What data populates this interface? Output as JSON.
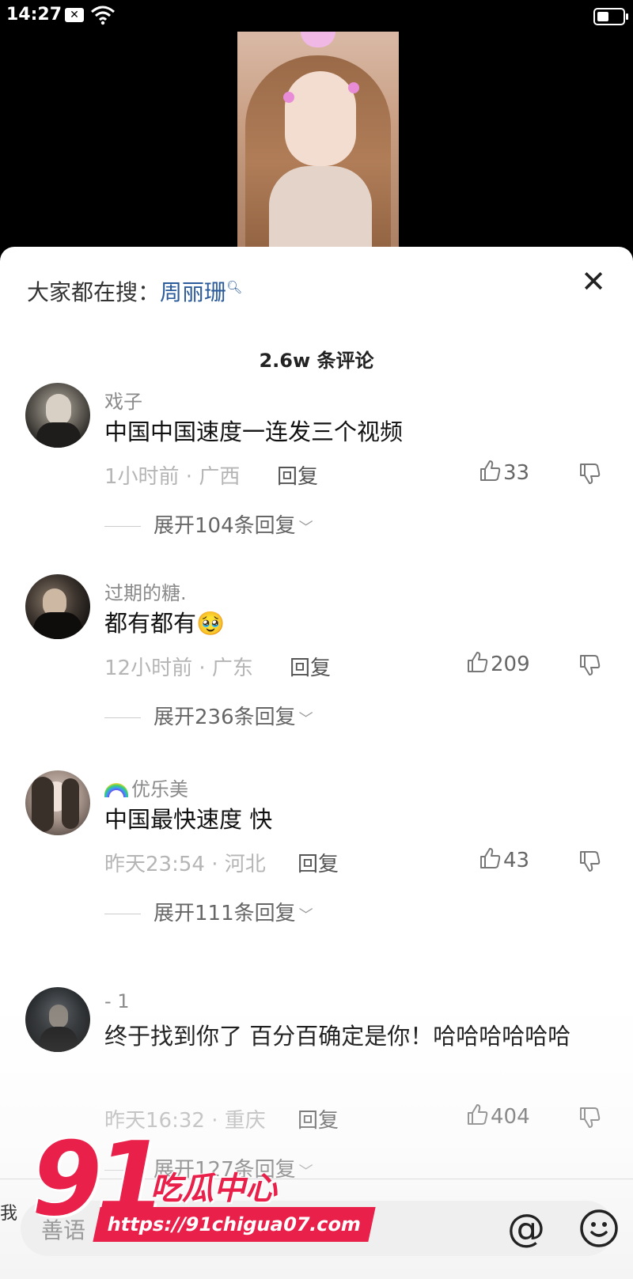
{
  "status": {
    "time": "14:27",
    "notification_icon": "x-badge-icon",
    "wifi_icon": "wifi-icon",
    "battery_icon": "battery-icon"
  },
  "sheet": {
    "search_label": "大家都在搜：",
    "search_keyword": "周丽珊",
    "comment_count": "2.6w 条评论"
  },
  "comments": [
    {
      "username": "戏子",
      "text": "中国中国速度一连发三个视频",
      "meta": "1小时前 · 广西",
      "reply_label": "回复",
      "likes": "33",
      "expand": "展开104条回复"
    },
    {
      "username": "过期的糖.",
      "text": "都有都有🥹",
      "meta": "12小时前 · 广东",
      "reply_label": "回复",
      "likes": "209",
      "expand": "展开236条回复"
    },
    {
      "username": "优乐美",
      "text": "中国最快速度 快",
      "meta": "昨天23:54 · 河北",
      "reply_label": "回复",
      "likes": "43",
      "expand": "展开111条回复"
    },
    {
      "username": "- 1",
      "text": "终于找到你了 百分百确定是你！哈哈哈哈哈哈",
      "meta": "昨天16:32 · 重庆",
      "reply_label": "回复",
      "likes": "404",
      "expand": "展开127条回复"
    }
  ],
  "input": {
    "placeholder": "善语",
    "side_char": "我"
  },
  "watermark": {
    "logo_number": "91",
    "logo_text": "吃瓜中心",
    "url": "https://91chigua07.com"
  },
  "colors": {
    "accent_link": "#2b5b9a",
    "watermark_red": "#e8204a"
  }
}
